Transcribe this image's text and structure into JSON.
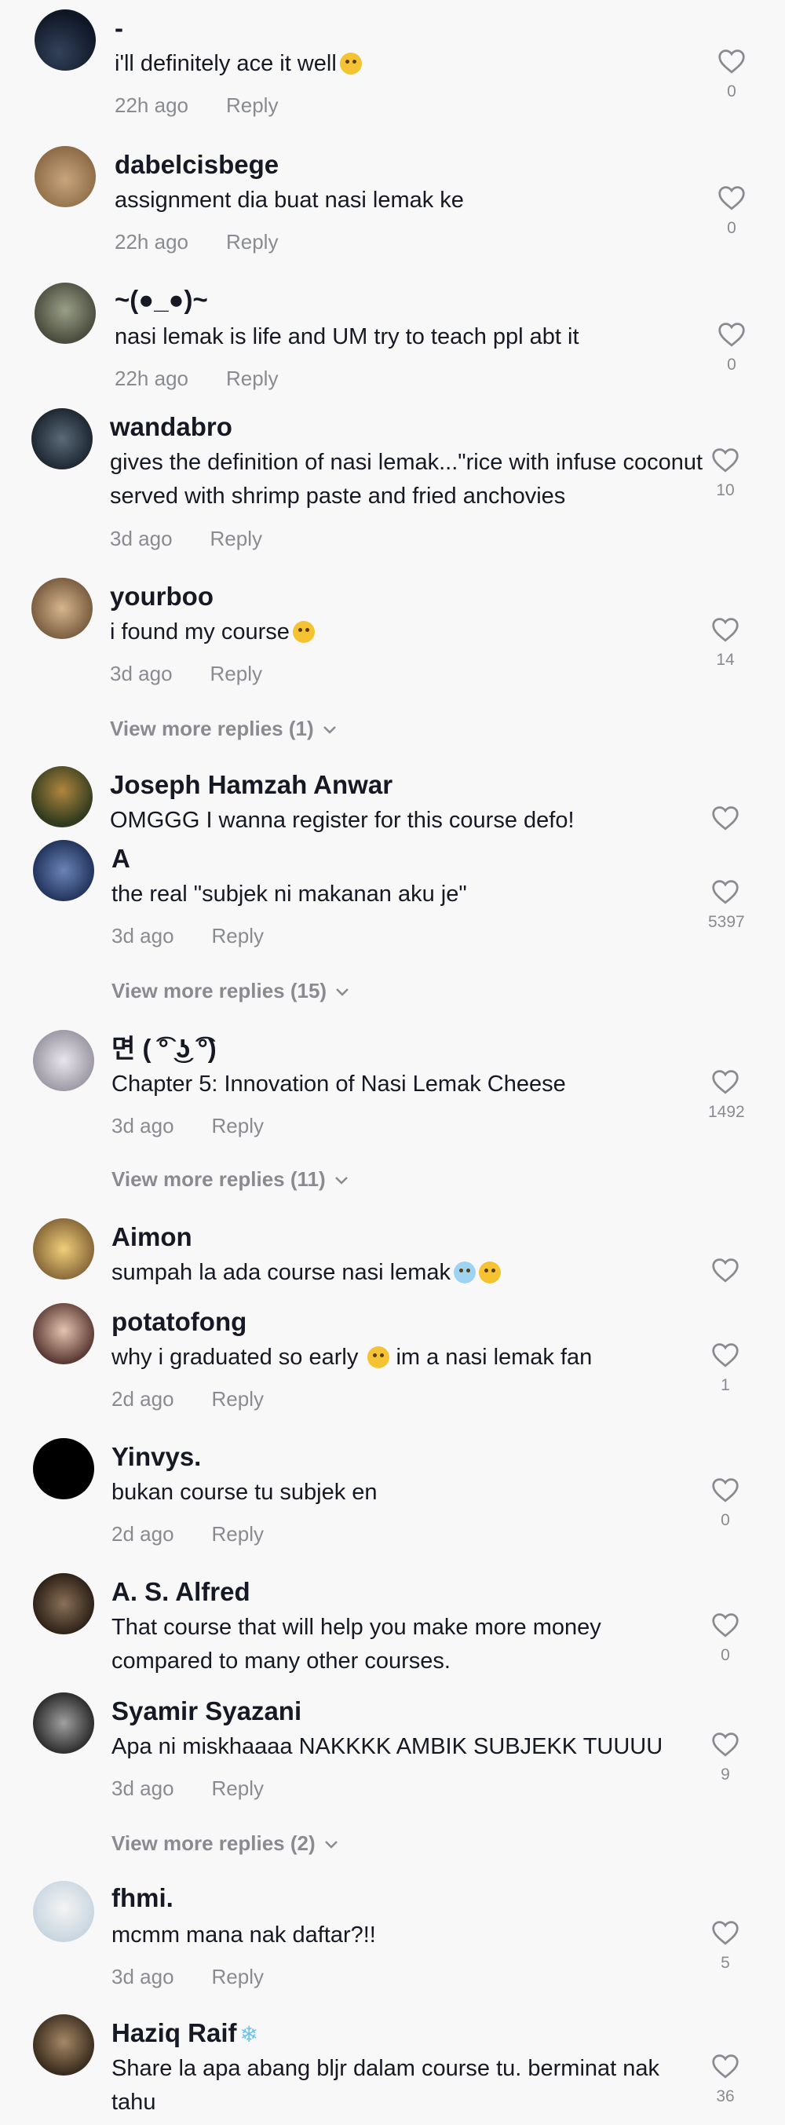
{
  "comments": [
    {
      "username": "-",
      "text": "i'll definitely ace it well",
      "emoji": "laughing",
      "time": "22h ago",
      "reply": "Reply",
      "likes": "0",
      "avatar_color": "#1d2a3c"
    },
    {
      "username": "dabelcisbege",
      "text": "assignment dia buat nasi lemak ke",
      "time": "22h ago",
      "reply": "Reply",
      "likes": "0",
      "avatar_color": "#a48660"
    },
    {
      "username": "~(●_●)~",
      "text": "nasi lemak is life and UM try to teach ppl abt it",
      "time": "22h ago",
      "reply": "Reply",
      "likes": "0",
      "avatar_color": "#6b6f5c"
    },
    {
      "username": "wandabro",
      "text": "gives the definition of nasi lemak...\"rice with infuse coconut served with shrimp paste and fried anchovies",
      "time": "3d ago",
      "reply": "Reply",
      "likes": "10",
      "avatar_color": "#2c3c4a"
    },
    {
      "username": "yourboo",
      "text": "i found my course",
      "emoji": "starstruck",
      "time": "3d ago",
      "reply": "Reply",
      "likes": "14",
      "avatar_color": "#b8926a",
      "view_more": "View more replies (1)"
    },
    {
      "username": "Joseph Hamzah Anwar",
      "text": "OMGGG I wanna register for this course defo!",
      "avatar_color": "#5e7b3c"
    },
    {
      "username": "A",
      "text": "the real \"subjek ni makanan aku je\"",
      "time": "3d ago",
      "reply": "Reply",
      "likes": "5397",
      "avatar_color": "#3b5a8a",
      "view_more": "View more replies (15)"
    },
    {
      "username": "면 ( ͡° ͜ʖ ͡°)",
      "text": "Chapter 5: Innovation of Nasi Lemak Cheese",
      "time": "3d ago",
      "reply": "Reply",
      "likes": "1492",
      "avatar_color": "#c6c3cc",
      "view_more": "View more replies (11)"
    },
    {
      "username": "Aimon",
      "text": "sumpah la ada course nasi lemak",
      "emoji": "crying-laughing",
      "avatar_color": "#d9a85a"
    },
    {
      "username": "potatofong",
      "text": "why i graduated so early",
      "emoji": "pleading",
      "text_after": "im a nasi lemak fan",
      "time": "2d ago",
      "reply": "Reply",
      "likes": "1",
      "avatar_color": "#a36d5a"
    },
    {
      "username": "Yinvys.",
      "text": "bukan course tu subjek en",
      "time": "2d ago",
      "reply": "Reply",
      "likes": "0",
      "avatar_color": "#000000"
    },
    {
      "username": "A. S. Alfred",
      "text": "That course that will help you make more money compared to many other courses.",
      "likes": "0",
      "avatar_color": "#5a4a3a"
    },
    {
      "username": "Syamir Syazani",
      "text": "Apa ni miskhaaaa NAKKKK AMBIK SUBJEKK TUUUU",
      "time": "3d ago",
      "reply": "Reply",
      "likes": "9",
      "avatar_color": "#6a6a6a",
      "view_more": "View more replies (2)"
    },
    {
      "username": "fhmi.",
      "text": "mcmm mana nak daftar?!!",
      "time": "3d ago",
      "reply": "Reply",
      "likes": "5",
      "avatar_color": "#dfe8ee"
    },
    {
      "username": "Haziq Raif",
      "username_emoji": "snowflake",
      "text": "Share la apa abang bljr dalam course tu. berminat nak tahu",
      "likes": "36",
      "avatar_color": "#6c5840"
    }
  ],
  "icons": {
    "like": "heart-outline-icon",
    "expand": "chevron-down-icon"
  }
}
